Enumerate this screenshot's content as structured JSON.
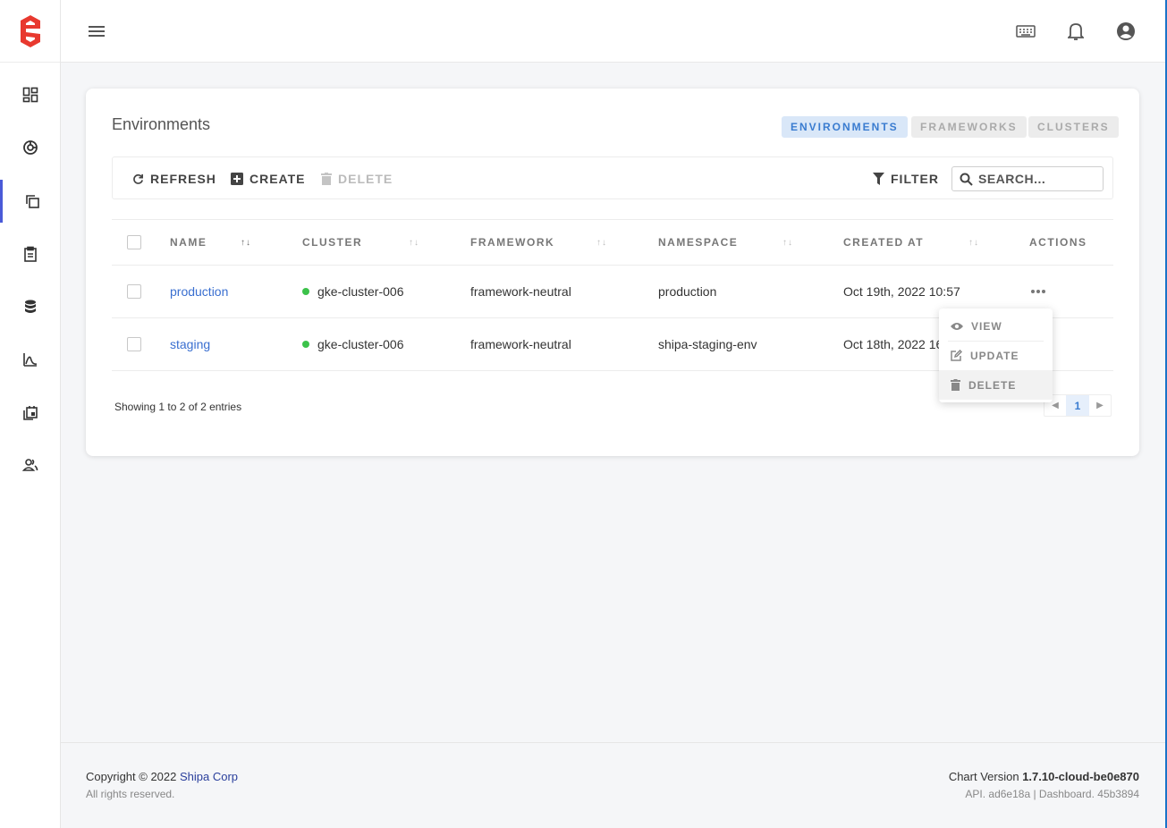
{
  "brand": {
    "accent": "#e8392f",
    "link": "#3a6fd0",
    "nav_active": "#4a5ad8"
  },
  "sidebar": {
    "items": [
      {
        "icon": "dashboard-icon"
      },
      {
        "icon": "apps-icon"
      },
      {
        "icon": "environments-icon",
        "active": true
      },
      {
        "icon": "clipboard-icon"
      },
      {
        "icon": "database-icon"
      },
      {
        "icon": "chart-icon"
      },
      {
        "icon": "calendar-icon"
      },
      {
        "icon": "users-icon"
      }
    ]
  },
  "topbar": {
    "icons": [
      "menu-icon",
      "keyboard-icon",
      "bell-icon",
      "account-icon"
    ]
  },
  "page": {
    "title": "Environments",
    "tabs": [
      {
        "label": "ENVIRONMENTS",
        "active": true
      },
      {
        "label": "FRAMEWORKS",
        "active": false
      },
      {
        "label": "CLUSTERS",
        "active": false
      }
    ]
  },
  "toolbar": {
    "refresh": "REFRESH",
    "create": "CREATE",
    "delete": "DELETE",
    "filter": "FILTER",
    "search_placeholder": "SEARCH..."
  },
  "table": {
    "headers": {
      "name": "NAME",
      "cluster": "CLUSTER",
      "framework": "FRAMEWORK",
      "namespace": "NAMESPACE",
      "created_at": "CREATED AT",
      "actions": "ACTIONS"
    },
    "rows": [
      {
        "name": "production",
        "cluster": "gke-cluster-006",
        "framework": "framework-neutral",
        "namespace": "production",
        "created_at": "Oct 19th, 2022 10:57"
      },
      {
        "name": "staging",
        "cluster": "gke-cluster-006",
        "framework": "framework-neutral",
        "namespace": "shipa-staging-env",
        "created_at": "Oct 18th, 2022 16"
      }
    ],
    "showing": "Showing 1 to 2 of 2 entries",
    "page": "1"
  },
  "action_menu": {
    "view": "VIEW",
    "update": "UPDATE",
    "delete": "DELETE"
  },
  "footer": {
    "copyright": "Copyright © 2022",
    "company": "Shipa Corp",
    "rights": "All rights reserved.",
    "chart_version_label": "Chart Version",
    "chart_version": "1.7.10-cloud-be0e870",
    "build_info": "API. ad6e18a | Dashboard. 45b3894"
  }
}
